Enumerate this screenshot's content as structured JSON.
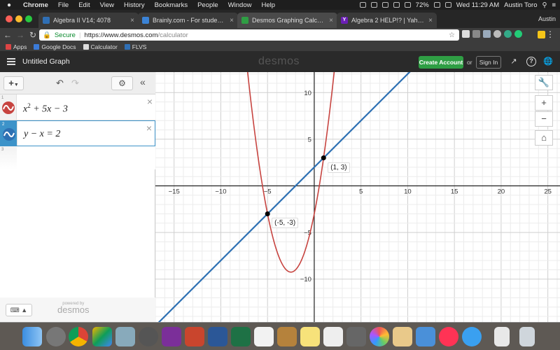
{
  "menubar": {
    "app": "Chrome",
    "menus": [
      "File",
      "Edit",
      "View",
      "History",
      "Bookmarks",
      "People",
      "Window",
      "Help"
    ],
    "battery": "72%",
    "clock": "Wed 11:29 AM",
    "user": "Austin Toro"
  },
  "tabs": [
    {
      "title": "Algebra II V14; 4078",
      "color": "#2f6fb5",
      "icon": "flvs-icon"
    },
    {
      "title": "Brainly.com - For students. By",
      "color": "#3b83d6",
      "icon": "brainly-icon"
    },
    {
      "title": "Desmos Graphing Calculator",
      "color": "#2f9e44",
      "icon": "desmos-icon"
    },
    {
      "title": "Algebra 2 HELP!? | Yahoo Ans",
      "color": "#6b1fb5",
      "icon": "yahoo-icon",
      "glyph": "Y"
    }
  ],
  "profile": "Austin",
  "address": {
    "secure_label": "Secure",
    "url_main": "https://www.desmos.com",
    "url_path": "/calculator"
  },
  "bookmarks": [
    {
      "label": "Apps",
      "color": "#d44"
    },
    {
      "label": "Google Docs",
      "color": "#3b7bd8"
    },
    {
      "label": "Calculator",
      "color": "#ddd"
    },
    {
      "label": "FLVS",
      "color": "#2f6fb5"
    }
  ],
  "header": {
    "graph_title": "Untitled Graph",
    "logo": "desmos",
    "create_account": "Create Account",
    "or": "or",
    "sign_in": "Sign In"
  },
  "expressions": [
    {
      "num": "1",
      "base": "x",
      "exp": "2",
      "rest": " + 5x − 3",
      "color": "#c74440"
    },
    {
      "num": "2",
      "text": "y − x = 2",
      "color": "#2d70b3"
    },
    {
      "num": "3"
    }
  ],
  "footer": {
    "powered_by": "powered by",
    "brand": "desmos"
  },
  "chart_data": {
    "type": "line",
    "xlim": [
      -17,
      26.3
    ],
    "ylim": [
      -14.6,
      12.2
    ],
    "x_ticks": [
      -15,
      -10,
      -5,
      5,
      10,
      15,
      20,
      25
    ],
    "y_ticks": [
      10,
      5,
      -5,
      -10
    ],
    "grid": true,
    "series": [
      {
        "expression": "y = x^2 + 5x - 3",
        "color": "#c74440",
        "kind": "parabola",
        "a": 1,
        "b": 5,
        "c": -3
      },
      {
        "expression": "y - x = 2",
        "color": "#2d70b3",
        "kind": "line",
        "slope": 1,
        "intercept": 2
      }
    ],
    "points": [
      {
        "x": 1,
        "y": 3,
        "label": "(1, 3)"
      },
      {
        "x": -5,
        "y": -3,
        "label": "(-5, -3)"
      }
    ]
  }
}
